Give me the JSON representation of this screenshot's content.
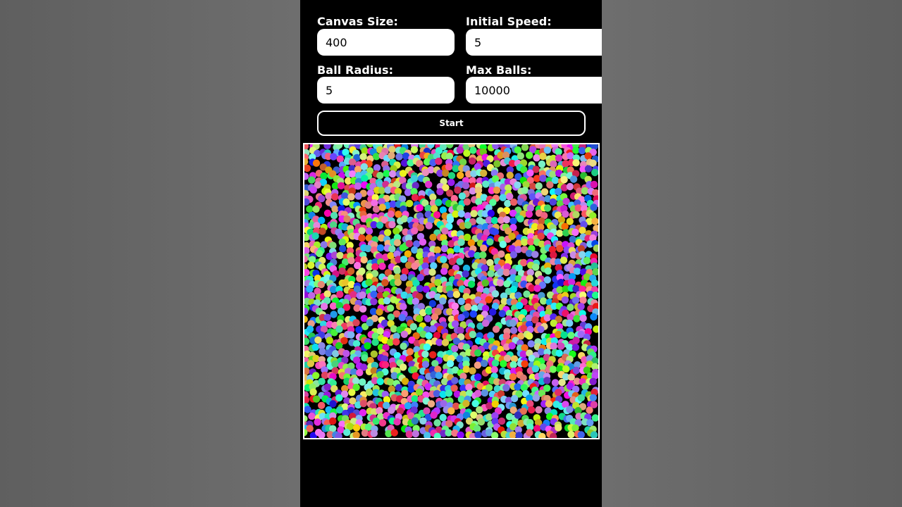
{
  "form": {
    "canvas_size": {
      "label": "Canvas Size:",
      "value": "400"
    },
    "initial_speed": {
      "label": "Initial Speed:",
      "value": "5"
    },
    "ball_radius": {
      "label": "Ball Radius:",
      "value": "5"
    },
    "max_balls": {
      "label": "Max Balls:",
      "value": "10000"
    },
    "start_label": "Start"
  },
  "simulation": {
    "background": "#000000",
    "border_color": "#ffffff",
    "ball_density": 0.85
  },
  "colors": {
    "page_bg": "#000000",
    "backdrop": "#6b6b6b",
    "input_bg": "#ffffff"
  }
}
